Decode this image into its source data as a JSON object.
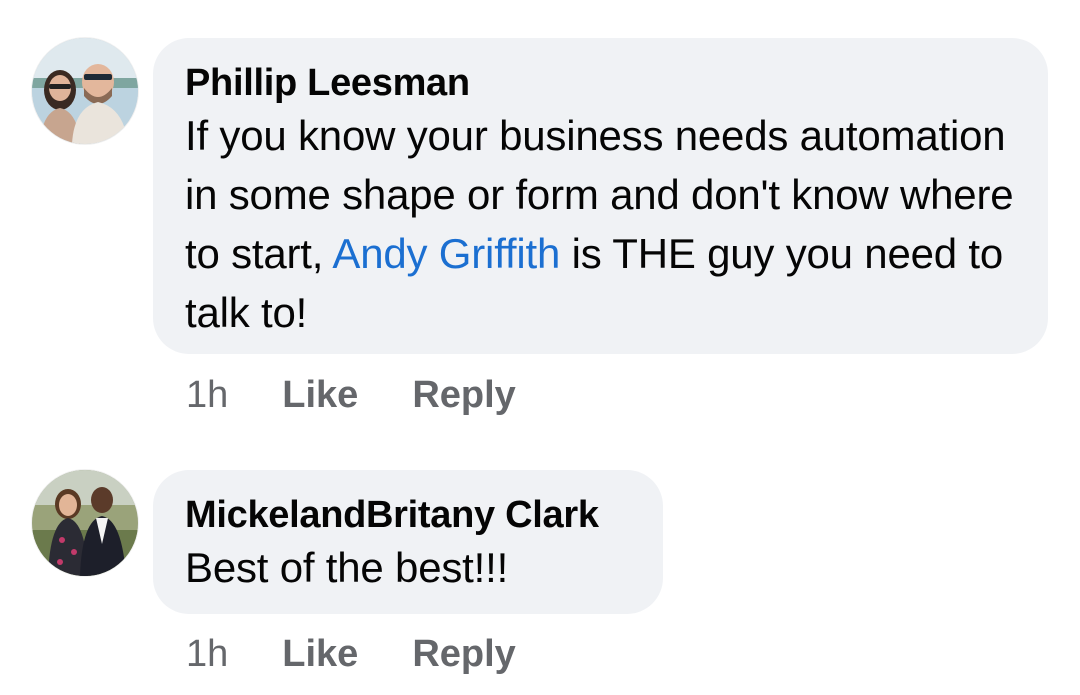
{
  "comments": [
    {
      "author": "Phillip Leesman",
      "text_before": "If you know your business needs automation in some shape or form and don't know where to start, ",
      "mention": "Andy Griffith",
      "text_after": " is THE guy you need to talk to!",
      "time": "1h",
      "like_label": "Like",
      "reply_label": "Reply"
    },
    {
      "author": "MickelandBritany Clark",
      "text": "Best of the best!!!",
      "time": "1h",
      "like_label": "Like",
      "reply_label": "Reply"
    }
  ],
  "colors": {
    "bubble": "#f0f2f5",
    "text": "#050505",
    "meta": "#65676b",
    "mention": "#1b6fd1"
  }
}
